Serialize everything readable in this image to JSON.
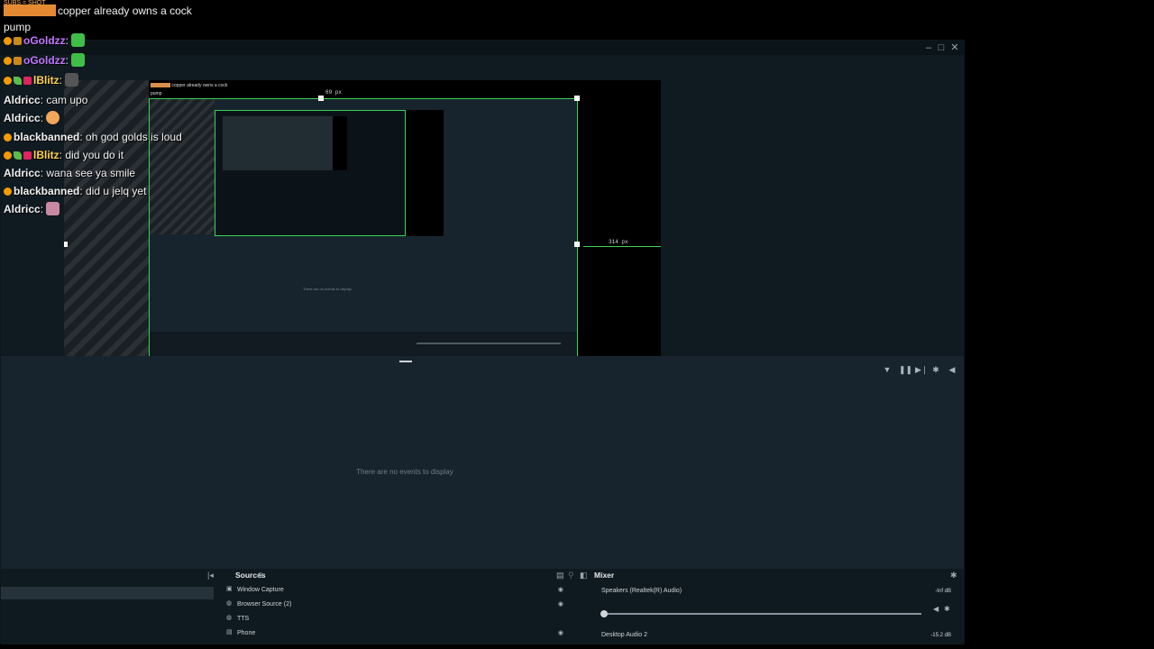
{
  "chat": {
    "sub_banner": "SUBS = SHOT",
    "first_line": "copper already owns a cock",
    "first_line_cont": "pump",
    "lines": [
      {
        "user": "oGoldzz",
        "user_color": "#c277ff",
        "text": ":",
        "emote": "green"
      },
      {
        "user": "oGoldzz",
        "user_color": "#c277ff",
        "text": ":",
        "emote": "green"
      },
      {
        "user": "lBlitz",
        "user_color": "#ffd34a",
        "text": ":",
        "emote": "gray"
      },
      {
        "user": "Aldricc",
        "user_color": "#f1f1f1",
        "text": ": cam upo",
        "emote": ""
      },
      {
        "user": "Aldricc",
        "user_color": "#f1f1f1",
        "text": ":",
        "emote": "face"
      },
      {
        "user": "blackbanned",
        "user_color": "#f1f1f1",
        "text": ": oh god golds is loud",
        "emote": ""
      },
      {
        "user": "lBlitz",
        "user_color": "#ffd34a",
        "text": ": did you do it",
        "emote": ""
      },
      {
        "user": "Aldricc",
        "user_color": "#f1f1f1",
        "text": ": wana see ya smile",
        "emote": ""
      },
      {
        "user": "blackbanned",
        "user_color": "#f1f1f1",
        "text": ": did u jelq yet",
        "emote": ""
      },
      {
        "user": "Aldricc",
        "user_color": "#f1f1f1",
        "text": ":",
        "emote": "pink"
      }
    ]
  },
  "preview": {
    "top_px_label": "69 px",
    "right_px_label": "314 px",
    "mini_chat_first": "copper already owns a cock",
    "mini_chat_second": "pump",
    "inner_message": "There are no events to display"
  },
  "events": {
    "empty_message": "There are no events to display",
    "toolbar": [
      "filter-icon",
      "pause-icon",
      "skip-icon",
      "settings-icon",
      "volume-icon"
    ]
  },
  "sources": {
    "title": "Sources",
    "items": [
      {
        "label": "Window Capture",
        "icon": "window-icon",
        "visible": true
      },
      {
        "label": "Browser Source (2)",
        "icon": "globe-icon",
        "visible": true
      },
      {
        "label": "TTS",
        "icon": "globe-icon",
        "visible": false
      },
      {
        "label": "Phone",
        "icon": "file-icon",
        "visible": true
      }
    ]
  },
  "mixer": {
    "title": "Mixer",
    "channels": [
      {
        "label": "Speakers (Realtek(R) Audio)",
        "db": "-Inf dB",
        "level": 0.0
      },
      {
        "label": "Desktop Audio 2",
        "db": "-15.2 dB"
      }
    ]
  },
  "colors": {
    "accent": "#39d353",
    "panel": "#17242d",
    "panel_dark": "#0f1a20"
  }
}
